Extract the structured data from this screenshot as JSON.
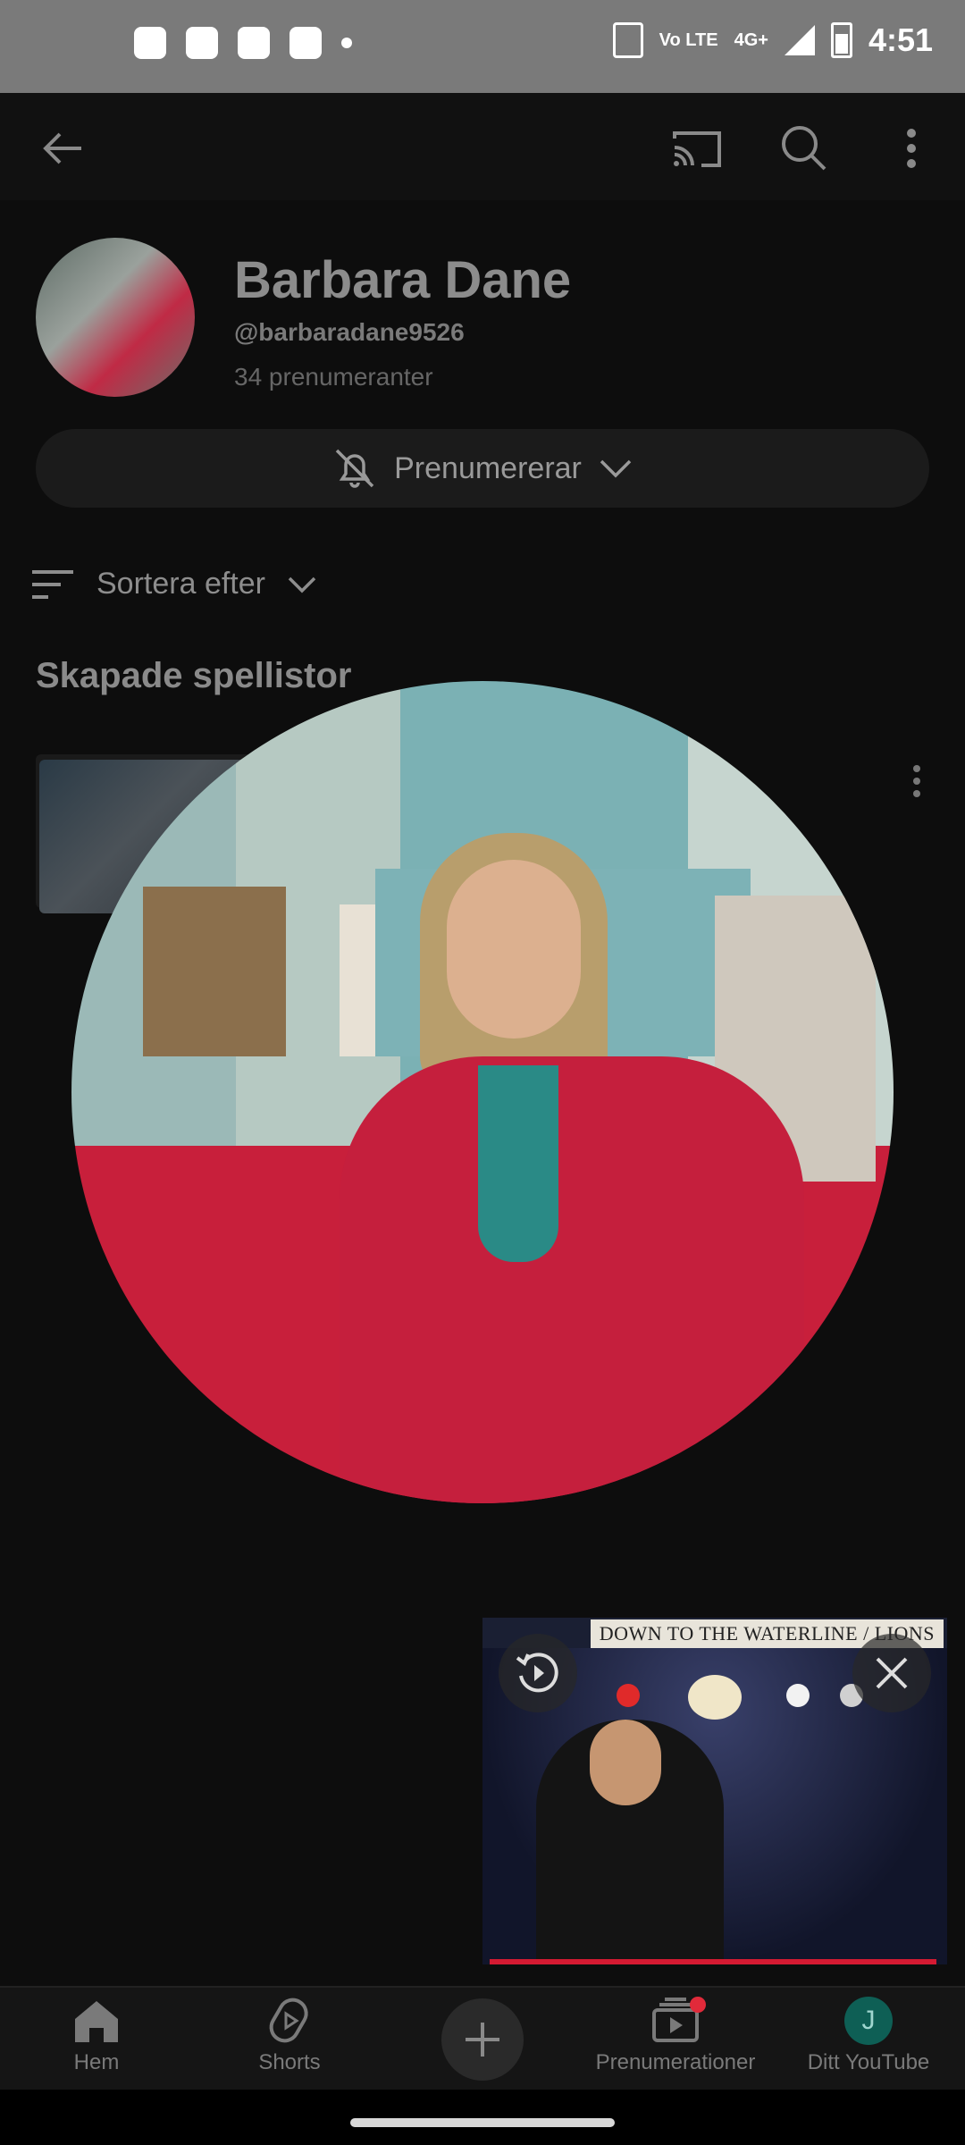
{
  "status_bar": {
    "time": "4:51",
    "network": "4G+",
    "volte": "Vo LTE"
  },
  "channel": {
    "name": "Barbara Dane",
    "handle": "@barbaradane9526",
    "subscribers": "34 prenumeranter",
    "subscribe_label": "Prenumererar"
  },
  "sort": {
    "label": "Sortera efter"
  },
  "section": {
    "title": "Skapade spellistor"
  },
  "mini_player": {
    "caption": "DOWN TO THE WATERLINE  /  LIONS"
  },
  "nav": [
    {
      "label": "Hem",
      "icon": "home-icon"
    },
    {
      "label": "Shorts",
      "icon": "shorts-icon"
    },
    {
      "label": "",
      "icon": "create-icon"
    },
    {
      "label": "Prenumerationer",
      "icon": "subscriptions-icon"
    },
    {
      "label": "Ditt YouTube",
      "icon": "avatar-icon",
      "avatar_letter": "J"
    }
  ],
  "colors": {
    "accent": "#d41a32",
    "avatar_teal": "#0e5f55"
  }
}
